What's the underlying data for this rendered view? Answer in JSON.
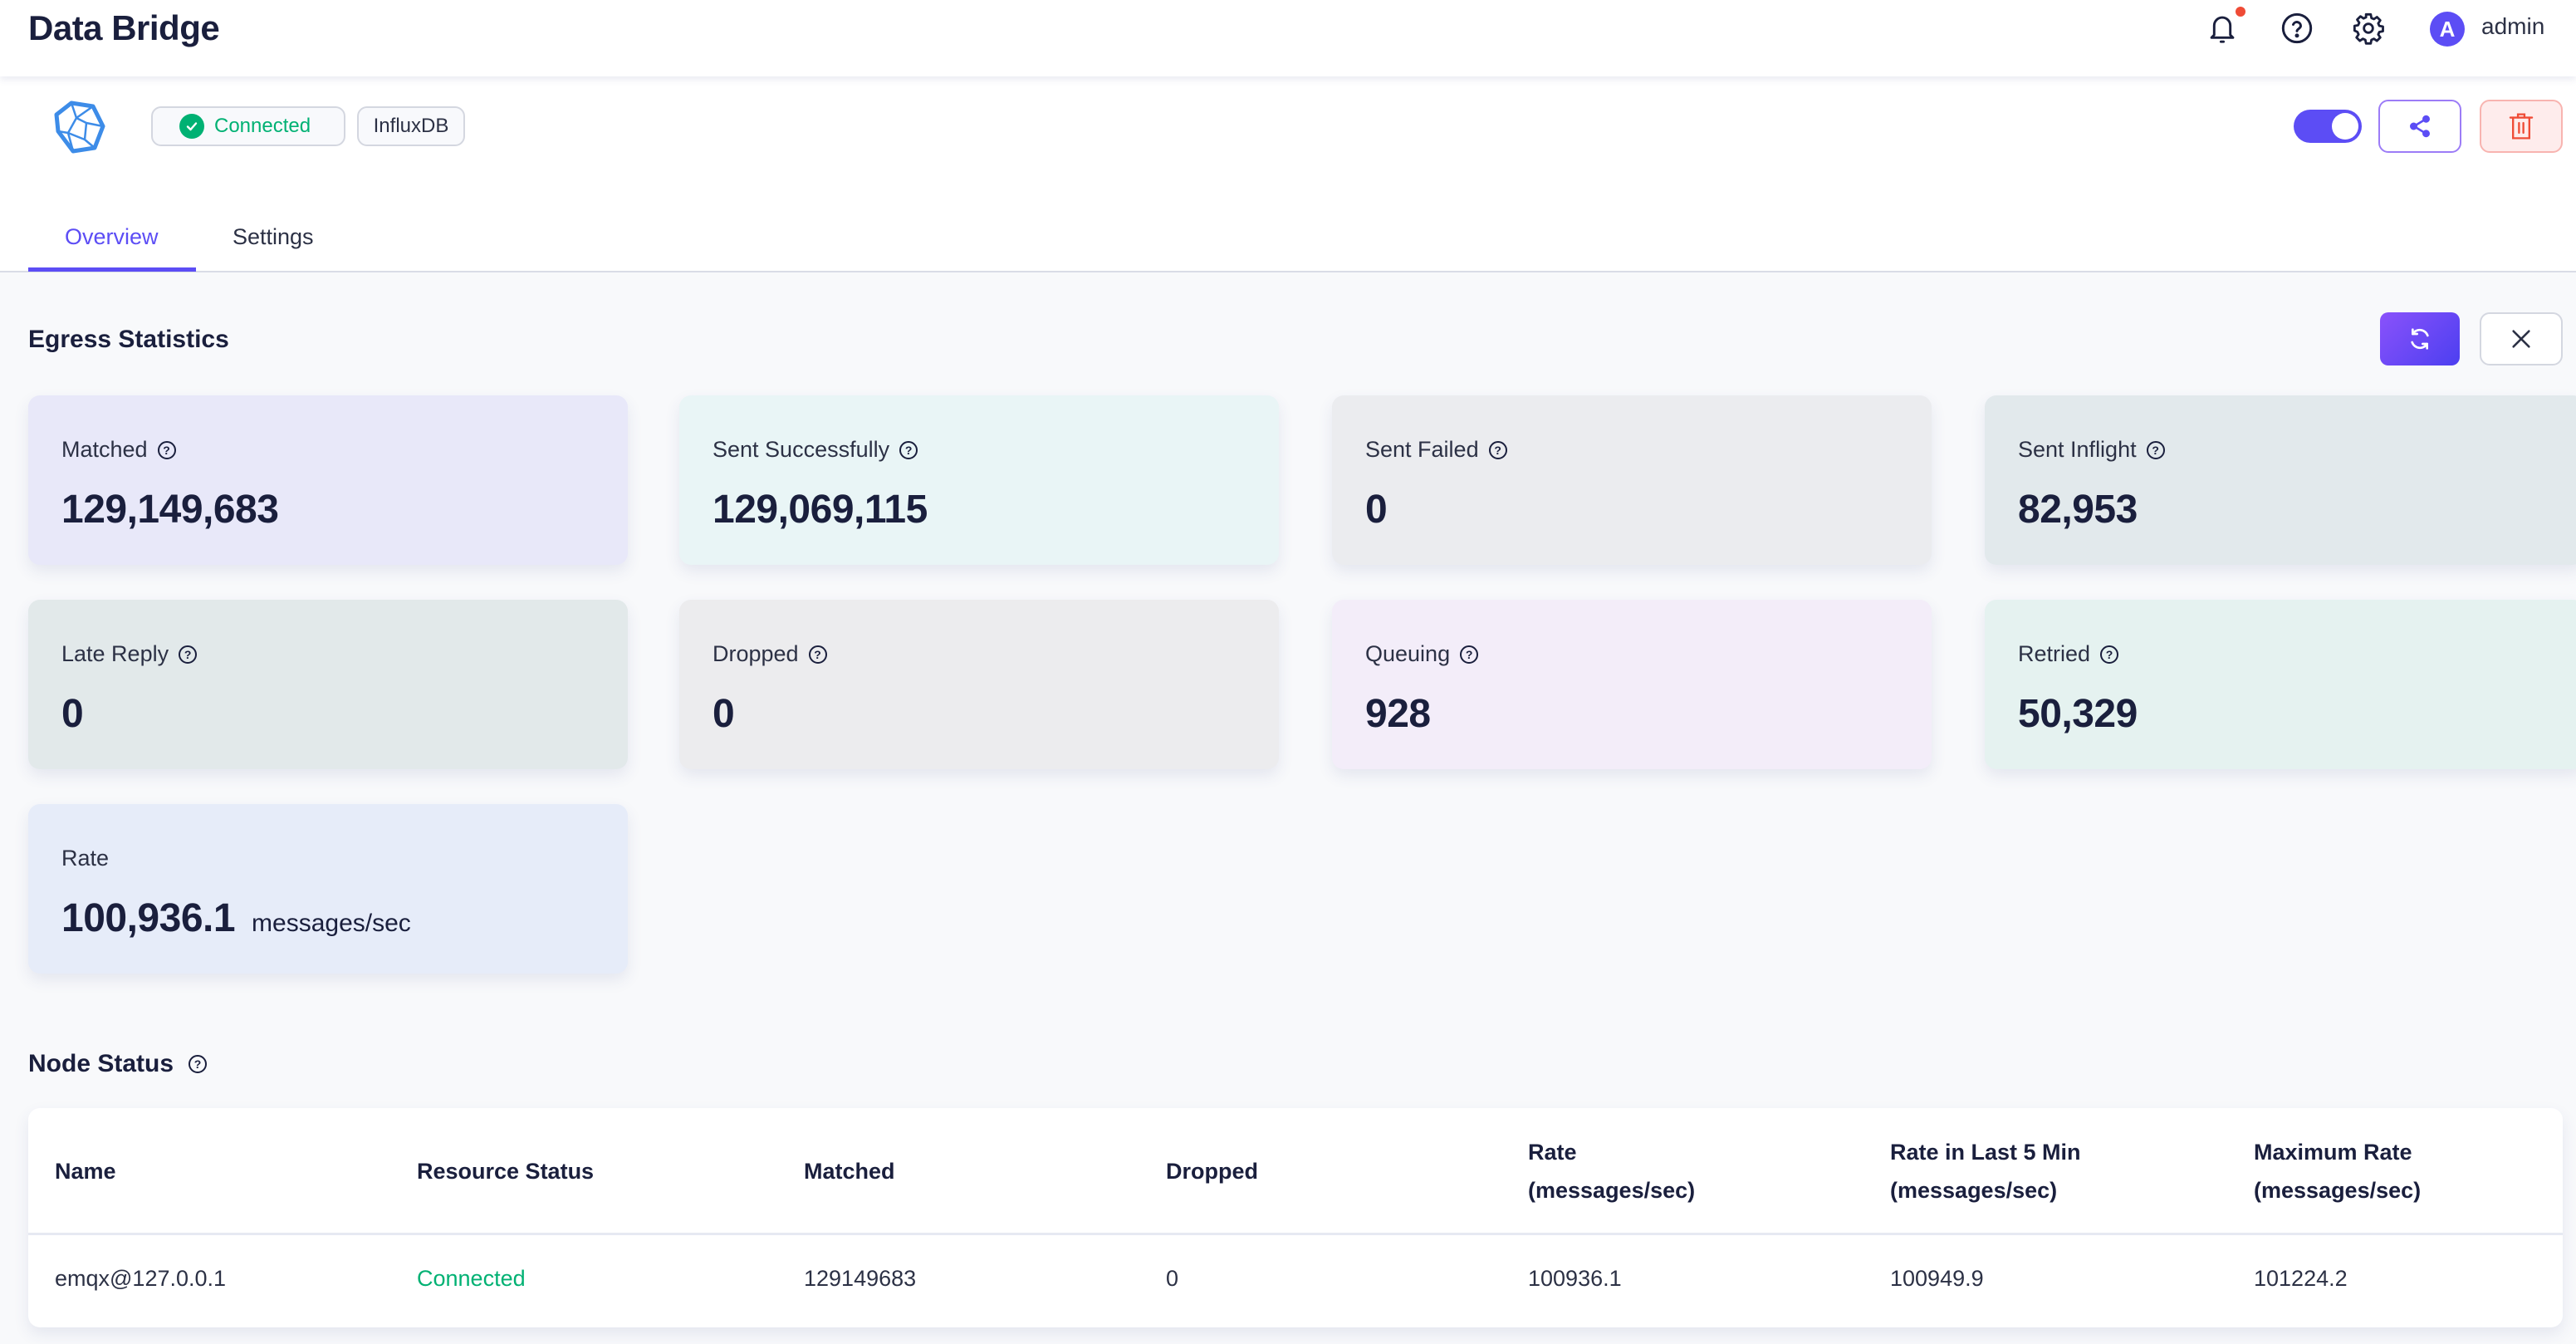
{
  "header": {
    "title": "Data Bridge",
    "icons": [
      "bell-icon",
      "help-circle-icon",
      "gear-icon"
    ],
    "notification_dot": true,
    "avatar_initial": "A",
    "username": "admin"
  },
  "bridge": {
    "logo_icon": "influxdb-icon",
    "status": "Connected",
    "type": "InfluxDB",
    "enabled": true
  },
  "tabs": [
    {
      "label": "Overview",
      "active": true
    },
    {
      "label": "Settings",
      "active": false
    }
  ],
  "egress": {
    "title": "Egress Statistics",
    "cards": [
      {
        "label": "Matched",
        "value": "129,149,683",
        "help": true,
        "bg": "#e8e8f9"
      },
      {
        "label": "Sent Successfully",
        "value": "129,069,115",
        "help": true,
        "bg": "#e9f5f6"
      },
      {
        "label": "Sent Failed",
        "value": "0",
        "help": true,
        "bg": "#ebecef"
      },
      {
        "label": "Sent Inflight",
        "value": "82,953",
        "help": true,
        "bg": "#e2e9ec"
      },
      {
        "label": "Late Reply",
        "value": "0",
        "help": true,
        "bg": "#e2e9ea"
      },
      {
        "label": "Dropped",
        "value": "0",
        "help": true,
        "bg": "#ececee"
      },
      {
        "label": "Queuing",
        "value": "928",
        "help": true,
        "bg": "#f3edf9"
      },
      {
        "label": "Retried",
        "value": "50,329",
        "help": true,
        "bg": "#e5f2f0"
      },
      {
        "label": "Rate",
        "value": "100,936.1",
        "unit": "messages/sec",
        "help": false,
        "bg": "#e6ecf9"
      }
    ]
  },
  "node_status": {
    "title": "Node Status",
    "columns": [
      "Name",
      "Resource Status",
      "Matched",
      "Dropped",
      "Rate\n(messages/sec)",
      "Rate in Last 5 Min\n(messages/sec)",
      "Maximum Rate\n(messages/sec)"
    ],
    "column_lines": [
      [
        "Name"
      ],
      [
        "Resource Status"
      ],
      [
        "Matched"
      ],
      [
        "Dropped"
      ],
      [
        "Rate",
        "(messages/sec)"
      ],
      [
        "Rate in Last 5 Min",
        "(messages/sec)"
      ],
      [
        "Maximum Rate",
        "(messages/sec)"
      ]
    ],
    "rows": [
      [
        "emqx@127.0.0.1",
        "Connected",
        "129149683",
        "0",
        "100936.1",
        "100949.9",
        "101224.2"
      ]
    ]
  },
  "colors": {
    "accent": "#5c4df5",
    "success": "#00b173",
    "danger": "#ef4b36"
  }
}
